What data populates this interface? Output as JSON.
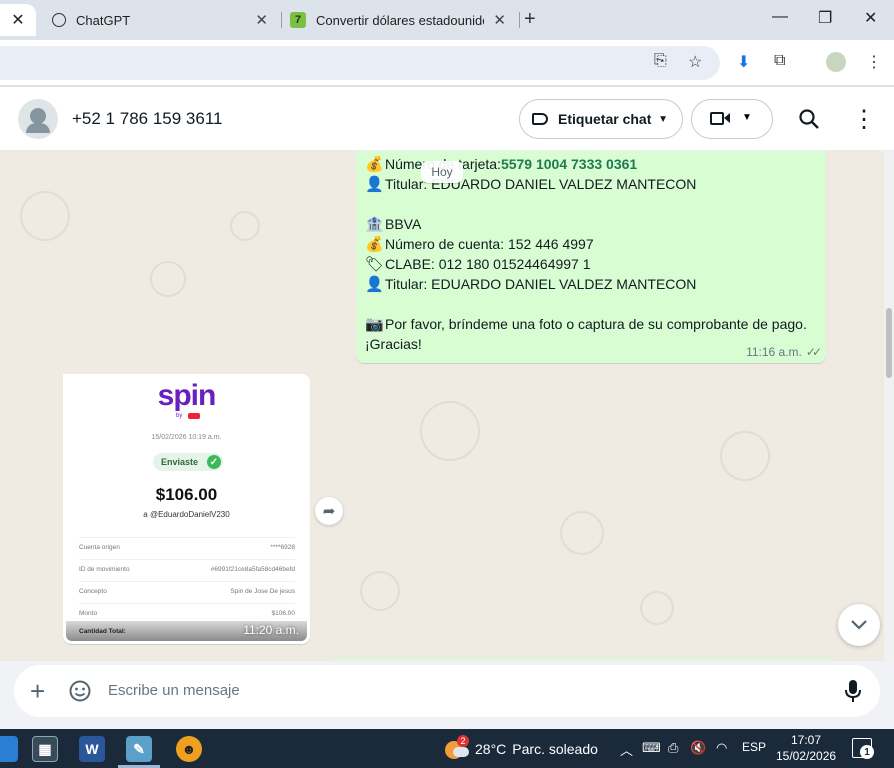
{
  "browser": {
    "tabs": [
      {
        "title": "ChatGPT"
      },
      {
        "title": "Convertir dólares estadounidenses"
      }
    ]
  },
  "header": {
    "contact": "+52 1 786 159 3611",
    "tag_chat_label": "Etiquetar chat"
  },
  "chat": {
    "date_chip": "Hoy",
    "outgoing": {
      "card_label": "Número de tarjeta: ",
      "card_number": "5579 1004 7333 0361",
      "holder1": "Titular: EDUARDO DANIEL VALDEZ MANTECON",
      "bank": "BBVA",
      "account": "Número de cuenta: 152 446 4997",
      "clabe": "CLABE: 012 180 01524464997 1",
      "holder2": "Titular: EDUARDO DANIEL VALDEZ MANTECON",
      "request": "Por favor, bríndeme una foto o captura de su comprobante de pago.",
      "thanks": "¡Gracias!",
      "time": "11:16 a.m."
    },
    "incoming_image": {
      "brand": "spin",
      "brand_sub": "by",
      "date": "15/02/2026 10:19 a.m.",
      "status": "Enviaste",
      "amount": "$106.00",
      "recipient": "a @EduardoDanielV230",
      "rows": [
        {
          "label": "Cuenta origen",
          "value": "****6928"
        },
        {
          "label": "ID de movimiento",
          "value": "#6991f21ce8a5fa58cd46befd"
        },
        {
          "label": "Concepto",
          "value": "Spin de Jose De jesus"
        },
        {
          "label": "Monto",
          "value": "$106.00"
        }
      ],
      "total_label": "Cantidad Total:",
      "time": "11:20 a.m."
    }
  },
  "compose": {
    "placeholder": "Escribe un mensaje"
  },
  "taskbar": {
    "weather_temp": "28°C",
    "weather_text": "Parc. soleado",
    "weather_badge": "2",
    "language": "ESP",
    "time": "17:07",
    "date": "15/02/2026",
    "notifications": "1"
  }
}
